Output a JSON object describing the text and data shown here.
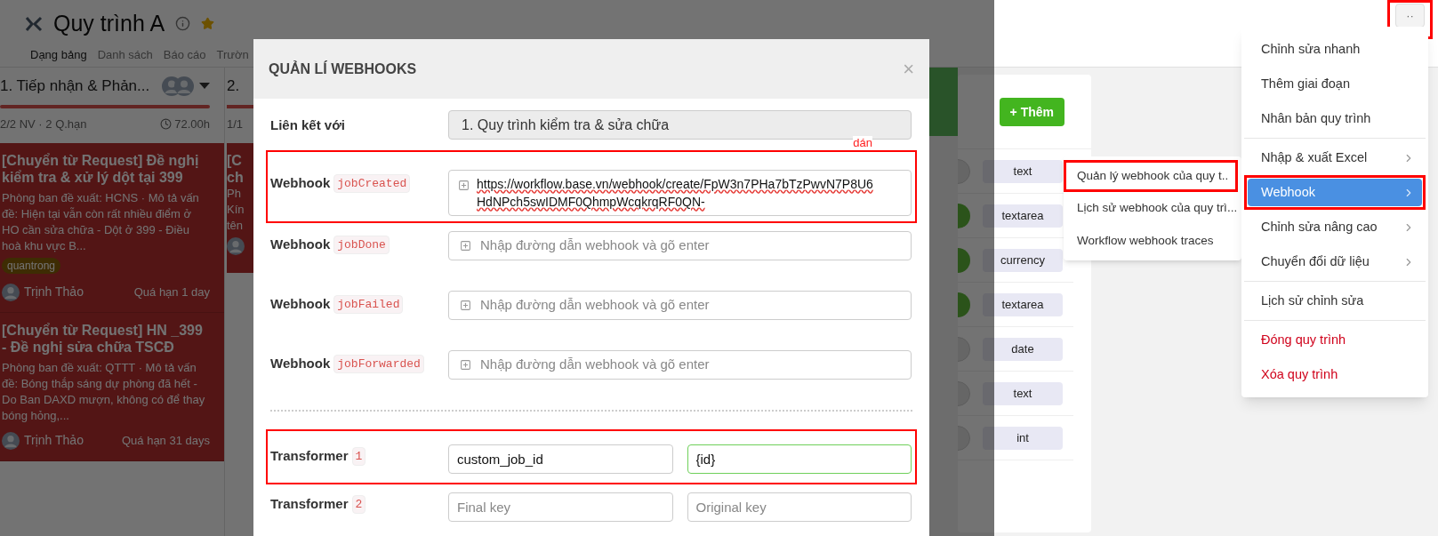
{
  "header": {
    "title": "Quy trình A",
    "tabs": [
      {
        "label": "Dạng bảng",
        "selected": true
      },
      {
        "label": "Danh sách",
        "selected": false
      },
      {
        "label": "Báo cáo",
        "selected": false
      },
      {
        "label": "Trườn",
        "selected": false
      }
    ],
    "more_button": {
      "label": "··",
      "highlighted": true
    }
  },
  "column_1": {
    "title": "1. Tiếp nhận & Phản...",
    "meta": "2/2 NV · 2 Q.hạn",
    "duration": "72.00h",
    "cards": [
      {
        "title": "[Chuyển từ Request] Đề nghị kiểm tra & xử lý dột tại 399",
        "description": "Phòng ban đề xuất: HCNS · Mô tả vấn đề: Hiện tại vẫn còn rất nhiều điểm ở HO cần sửa chữa - Dột ở 399 - Điều hoà khu vực B...",
        "tags": [
          "quantrong"
        ],
        "assignee": "Trịnh Thảo",
        "due": "Quá hạn 1 day"
      },
      {
        "title": "[Chuyển từ Request] HN _399 - Đề nghị sửa chữa TSCĐ",
        "description": "Phòng ban đề xuất: QTTT · Mô tả vấn đề: Bóng thắp sáng dự phòng đã hết - Do Ban DAXD mượn, không có để thay bóng hỏng,...",
        "assignee": "Trịnh Thảo",
        "due": "Quá hạn 31 days"
      }
    ]
  },
  "column_2": {
    "title": "2.",
    "meta": "1/1",
    "card_title_lines": [
      "[C",
      "ch"
    ],
    "card_text_lines": [
      "Ph",
      "Kín",
      "tên"
    ]
  },
  "fields_panel": {
    "add_button": "+ Thêm",
    "fields": [
      {
        "type": "text",
        "on": false
      },
      {
        "type": "textarea",
        "on": true
      },
      {
        "type": "currency",
        "on": true
      },
      {
        "type": "textarea",
        "on": true
      },
      {
        "type": "date",
        "on": false
      },
      {
        "type": "text",
        "on": false
      },
      {
        "type": "int",
        "on": false
      }
    ]
  },
  "modal": {
    "title": "QUẢN LÍ WEBHOOKS",
    "close": "×",
    "link": {
      "label": "Liên kết với",
      "value": "1. Quy trình kiểm tra & sửa chữa"
    },
    "note": "dán",
    "webhooks": [
      {
        "label": "Webhook",
        "event": "jobCreated",
        "value_lines": [
          "https://workflow.base.vn/webhook/create/FpW3n7PHa7bTzPwvN7P8U6",
          "HdNPch5swIDMF0QhmpWcqkrqRF0QN-"
        ],
        "highlighted": true
      },
      {
        "label": "Webhook",
        "event": "jobDone",
        "placeholder": "Nhập đường dẫn webhook và gõ enter",
        "highlighted": false
      },
      {
        "label": "Webhook",
        "event": "jobFailed",
        "placeholder": "Nhập đường dẫn webhook và gõ enter",
        "highlighted": false
      },
      {
        "label": "Webhook",
        "event": "jobForwarded",
        "placeholder": "Nhập đường dẫn webhook và gõ enter",
        "highlighted": false
      }
    ],
    "transformers": [
      {
        "label": "Transformer",
        "index": "1",
        "final_key": "custom_job_id",
        "original_key": "{id}",
        "focused": true,
        "highlighted": true
      },
      {
        "label": "Transformer",
        "index": "2",
        "final_key_placeholder": "Final key",
        "original_key_placeholder": "Original key",
        "focused": false,
        "highlighted": false
      }
    ]
  },
  "menu": {
    "groups": [
      [
        {
          "label": "Chỉnh sửa nhanh",
          "kind": "normal",
          "has_submenu": false,
          "selected": false,
          "highlighted": false
        },
        {
          "label": "Thêm giai đoạn",
          "kind": "normal",
          "has_submenu": false,
          "selected": false,
          "highlighted": false
        },
        {
          "label": "Nhân bản quy trình",
          "kind": "normal",
          "has_submenu": false,
          "selected": false,
          "highlighted": false
        }
      ],
      [
        {
          "label": "Nhập & xuất Excel",
          "kind": "normal",
          "has_submenu": true,
          "selected": false,
          "highlighted": false
        },
        {
          "label": "Webhook",
          "kind": "normal",
          "has_submenu": true,
          "selected": true,
          "highlighted": true
        },
        {
          "label": "Chỉnh sửa nâng cao",
          "kind": "normal",
          "has_submenu": true,
          "selected": false,
          "highlighted": false
        },
        {
          "label": "Chuyển đổi dữ liệu",
          "kind": "normal",
          "has_submenu": true,
          "selected": false,
          "highlighted": false
        }
      ],
      [
        {
          "label": "Lịch sử chỉnh sửa",
          "kind": "normal",
          "has_submenu": false,
          "selected": false,
          "highlighted": false
        }
      ],
      [
        {
          "label": "Đóng quy trình",
          "kind": "danger",
          "has_submenu": false,
          "selected": false,
          "highlighted": false
        },
        {
          "label": "Xóa quy trình",
          "kind": "danger",
          "has_submenu": false,
          "selected": false,
          "highlighted": false
        }
      ]
    ]
  },
  "submenu": {
    "items": [
      {
        "label": "Quản lý webhook của quy t..",
        "highlighted": true
      },
      {
        "label": "Lịch sử webhook của quy trì...",
        "highlighted": false
      },
      {
        "label": "Workflow webhook traces",
        "highlighted": false
      }
    ]
  }
}
